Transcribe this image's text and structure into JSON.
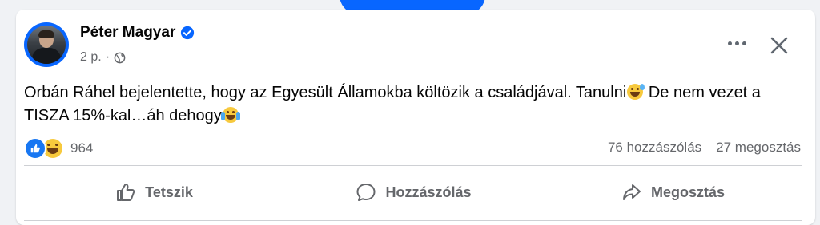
{
  "post": {
    "author": "Péter Magyar",
    "time": "2 p.",
    "text_part1": "Orbán Ráhel bejelentette, hogy az Egyesült Államokba költözik a családjával. Tanulni",
    "text_part2": " De nem vezet a TISZA 15%-kal…áh dehogy",
    "reaction_count": "964",
    "comments": "76 hozzászólás",
    "shares": "27 megosztás"
  },
  "actions": {
    "like": "Tetszik",
    "comment": "Hozzászólás",
    "share": "Megosztás"
  },
  "icons": {
    "verified": "verified-badge-icon",
    "privacy": "globe-icon",
    "more": "more-dots-icon",
    "close": "close-icon",
    "like": "thumbs-up-icon",
    "comment": "speech-bubble-icon",
    "share": "share-arrow-icon"
  },
  "colors": {
    "accent": "#0866ff",
    "text": "#050505",
    "secondary": "#65676b",
    "background": "#f0f2f5"
  }
}
